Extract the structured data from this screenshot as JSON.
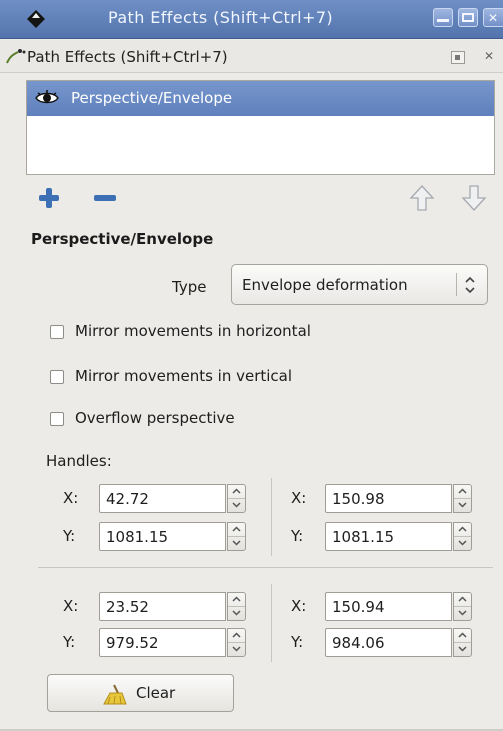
{
  "window": {
    "title": "Path Effects  (Shift+Ctrl+7)",
    "icon": "inkscape-diamond-icon",
    "controls": [
      "minimize-icon",
      "maximize-icon",
      "close-icon"
    ]
  },
  "dock": {
    "title": "Path Effects (Shift+Ctrl+7)",
    "icon": "path-effects-icon",
    "controls": [
      "dock-float-icon",
      "dock-close-icon"
    ]
  },
  "effects_list": {
    "items": [
      {
        "label": "Perspective/Envelope",
        "visible_icon": "eye-icon",
        "selected": true
      }
    ]
  },
  "toolbar": {
    "add_icon": "plus-icon",
    "remove_icon": "minus-icon",
    "move_up_icon": "arrow-up-icon",
    "move_down_icon": "arrow-down-icon"
  },
  "params": {
    "section_title": "Perspective/Envelope",
    "type_label": "Type",
    "type_value": "Envelope deformation",
    "checkboxes": [
      {
        "label": "Mirror movements in horizontal",
        "checked": false
      },
      {
        "label": "Mirror movements in vertical",
        "checked": false
      },
      {
        "label": "Overflow perspective",
        "checked": false
      }
    ],
    "handles_label": "Handles:",
    "handles": {
      "x_label": "X:",
      "y_label": "Y:",
      "top_left": {
        "x": "42.72",
        "y": "1081.15"
      },
      "top_right": {
        "x": "150.98",
        "y": "1081.15"
      },
      "bottom_left": {
        "x": "23.52",
        "y": "979.52"
      },
      "bottom_right": {
        "x": "150.94",
        "y": "984.06"
      }
    },
    "clear_label": "Clear"
  },
  "colors": {
    "titlebar": "#5f80bd",
    "selection": "#6b8ac5",
    "panel": "#ecebe8",
    "add_icon": "#3d6fb5",
    "remove_icon": "#3d6fb5"
  }
}
